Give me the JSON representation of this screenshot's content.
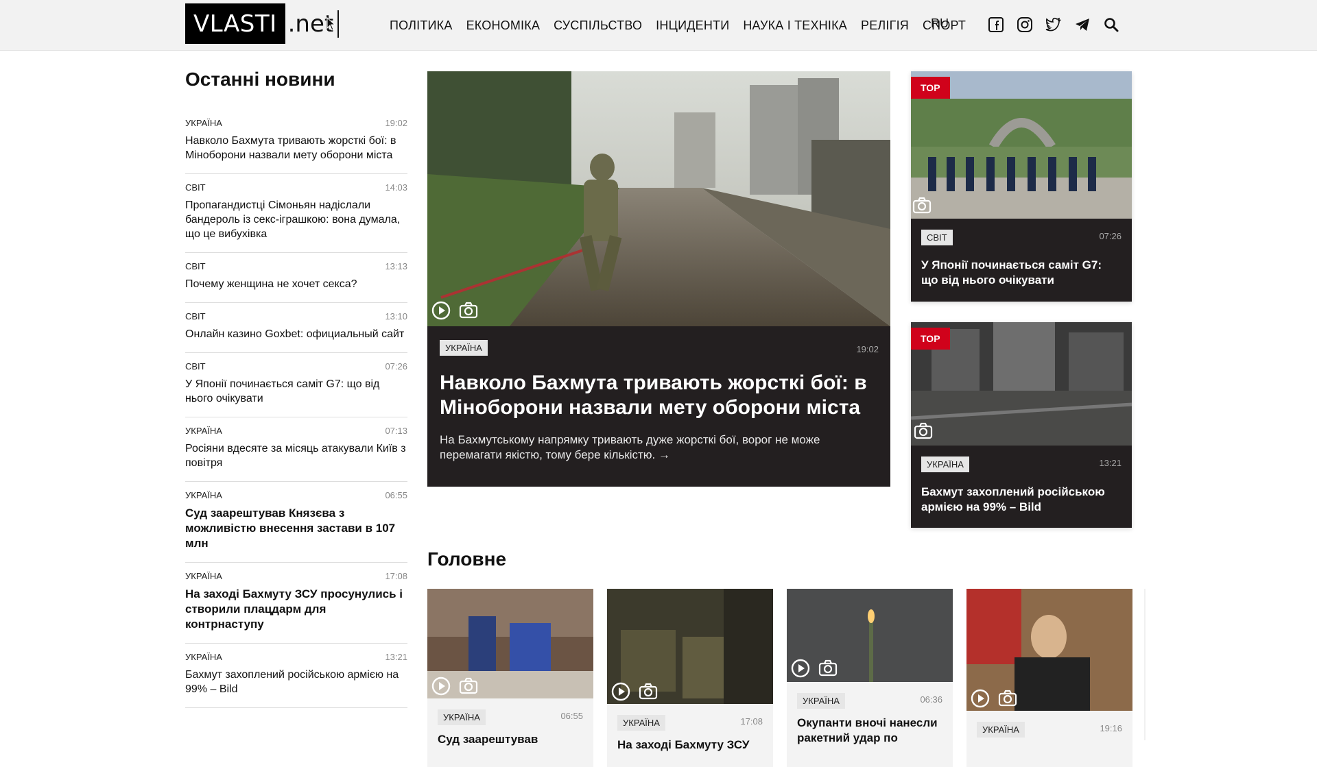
{
  "header": {
    "logo_main": "VLASTI",
    "logo_suffix": ".net",
    "nav": [
      "ПОЛІТИКА",
      "ЕКОНОМІКА",
      "СУСПІЛЬСТВО",
      "ІНЦИДЕНТИ",
      "НАУКА І ТЕХНІКА",
      "РЕЛІГІЯ",
      "СПОРТ"
    ],
    "lang": "RU",
    "icons": [
      "facebook-icon",
      "instagram-icon",
      "twitter-icon",
      "telegram-icon",
      "search-icon"
    ]
  },
  "latest": {
    "title": "Останні новини",
    "items": [
      {
        "cat": "УКРАЇНА",
        "time": "19:02",
        "text": "Навколо Бахмута тривають жорсткі бої: в Міноборони назвали мету оборони міста",
        "bold": false
      },
      {
        "cat": "СВІТ",
        "time": "14:03",
        "text": "Пропагандистці Сімоньян надіслали бандероль із секс-іграшкою: вона думала, що це вибухівка",
        "bold": false
      },
      {
        "cat": "СВІТ",
        "time": "13:13",
        "text": "Почему женщина не хочет секса?",
        "bold": false
      },
      {
        "cat": "СВІТ",
        "time": "13:10",
        "text": "Онлайн казино Goxbet: официальный сайт",
        "bold": false
      },
      {
        "cat": "СВІТ",
        "time": "07:26",
        "text": "У Японії починається саміт G7: що від нього очікувати",
        "bold": false
      },
      {
        "cat": "УКРАЇНА",
        "time": "07:13",
        "text": "Росіяни вдесяте за місяць атакували Київ з повітря",
        "bold": false
      },
      {
        "cat": "УКРАЇНА",
        "time": "06:55",
        "text": "Суд заарештував Князєва з можливістю внесення застави в 107 млн",
        "bold": true
      },
      {
        "cat": "УКРАЇНА",
        "time": "17:08",
        "text": "На заході Бахмуту ЗСУ просунулись і створили плацдарм для контрнаступу",
        "bold": true
      },
      {
        "cat": "УКРАЇНА",
        "time": "13:21",
        "text": "Бахмут захоплений російською армією на 99% – Bild",
        "bold": false
      }
    ]
  },
  "featured": {
    "tag": "УКРАЇНА",
    "time": "19:02",
    "title": "Навколо Бахмута тривають жорсткі бої: в Міноборони назвали мету оборони міста",
    "lead": "На Бахмутському напрямку тривають дуже жорсткі бої, ворог не може перемагати якістю, тому бере кількістю.  →"
  },
  "top_cards": [
    {
      "badge": "TOP",
      "tag": "СВІТ",
      "time": "07:26",
      "title": "У Японії починається саміт G7: що від нього очікувати"
    },
    {
      "badge": "TOP",
      "tag": "УКРАЇНА",
      "time": "13:21",
      "title": "Бахмут захоплений російською армією на 99% – Bild"
    }
  ],
  "main": {
    "title": "Головне",
    "cards": [
      {
        "tag": "УКРАЇНА",
        "time": "06:55",
        "title": "Суд заарештував"
      },
      {
        "tag": "УКРАЇНА",
        "time": "17:08",
        "title": "На заході Бахмуту ЗСУ"
      },
      {
        "tag": "УКРАЇНА",
        "time": "06:36",
        "title": "Окупанти вночі нанесли ракетний удар по"
      },
      {
        "tag": "УКРАЇНА",
        "time": "19:16",
        "title": ""
      }
    ]
  }
}
